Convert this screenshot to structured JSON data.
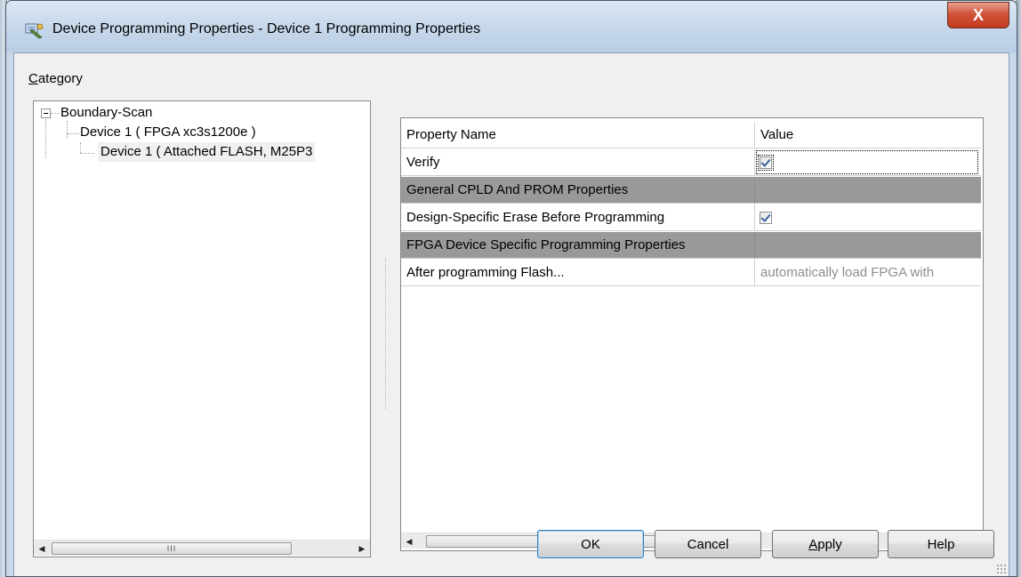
{
  "window": {
    "title": "Device Programming Properties - Device 1 Programming Properties",
    "close_label": "X"
  },
  "category": {
    "label_prefix": "C",
    "label_rest": "ategory",
    "tree": [
      {
        "label": "Boundary-Scan",
        "level": 0,
        "expanded": true
      },
      {
        "label": "Device 1 ( FPGA xc3s1200e )",
        "level": 1
      },
      {
        "label": "Device 1 ( Attached FLASH, M25P3",
        "level": 2,
        "selected": true
      }
    ],
    "scrollbar_grip": "III"
  },
  "properties": {
    "headers": {
      "name": "Property Name",
      "value": "Value"
    },
    "rows": [
      {
        "name": "Verify",
        "type": "checkbox",
        "checked": true
      },
      {
        "name": "General CPLD And PROM Properties",
        "type": "category"
      },
      {
        "name": "Design-Specific Erase Before Programming",
        "type": "checkbox",
        "checked": true
      },
      {
        "name": "FPGA Device Specific Programming Properties",
        "type": "category"
      },
      {
        "name": "After programming Flash...",
        "type": "text",
        "value": "automatically load FPGA with"
      }
    ],
    "scrollbar_grip": "III"
  },
  "buttons": {
    "ok": "OK",
    "cancel": "Cancel",
    "apply_prefix": "A",
    "apply_rest": "pply",
    "help": "Help"
  },
  "colors": {
    "category_row": "#999999",
    "close_button": "#c43b20"
  }
}
